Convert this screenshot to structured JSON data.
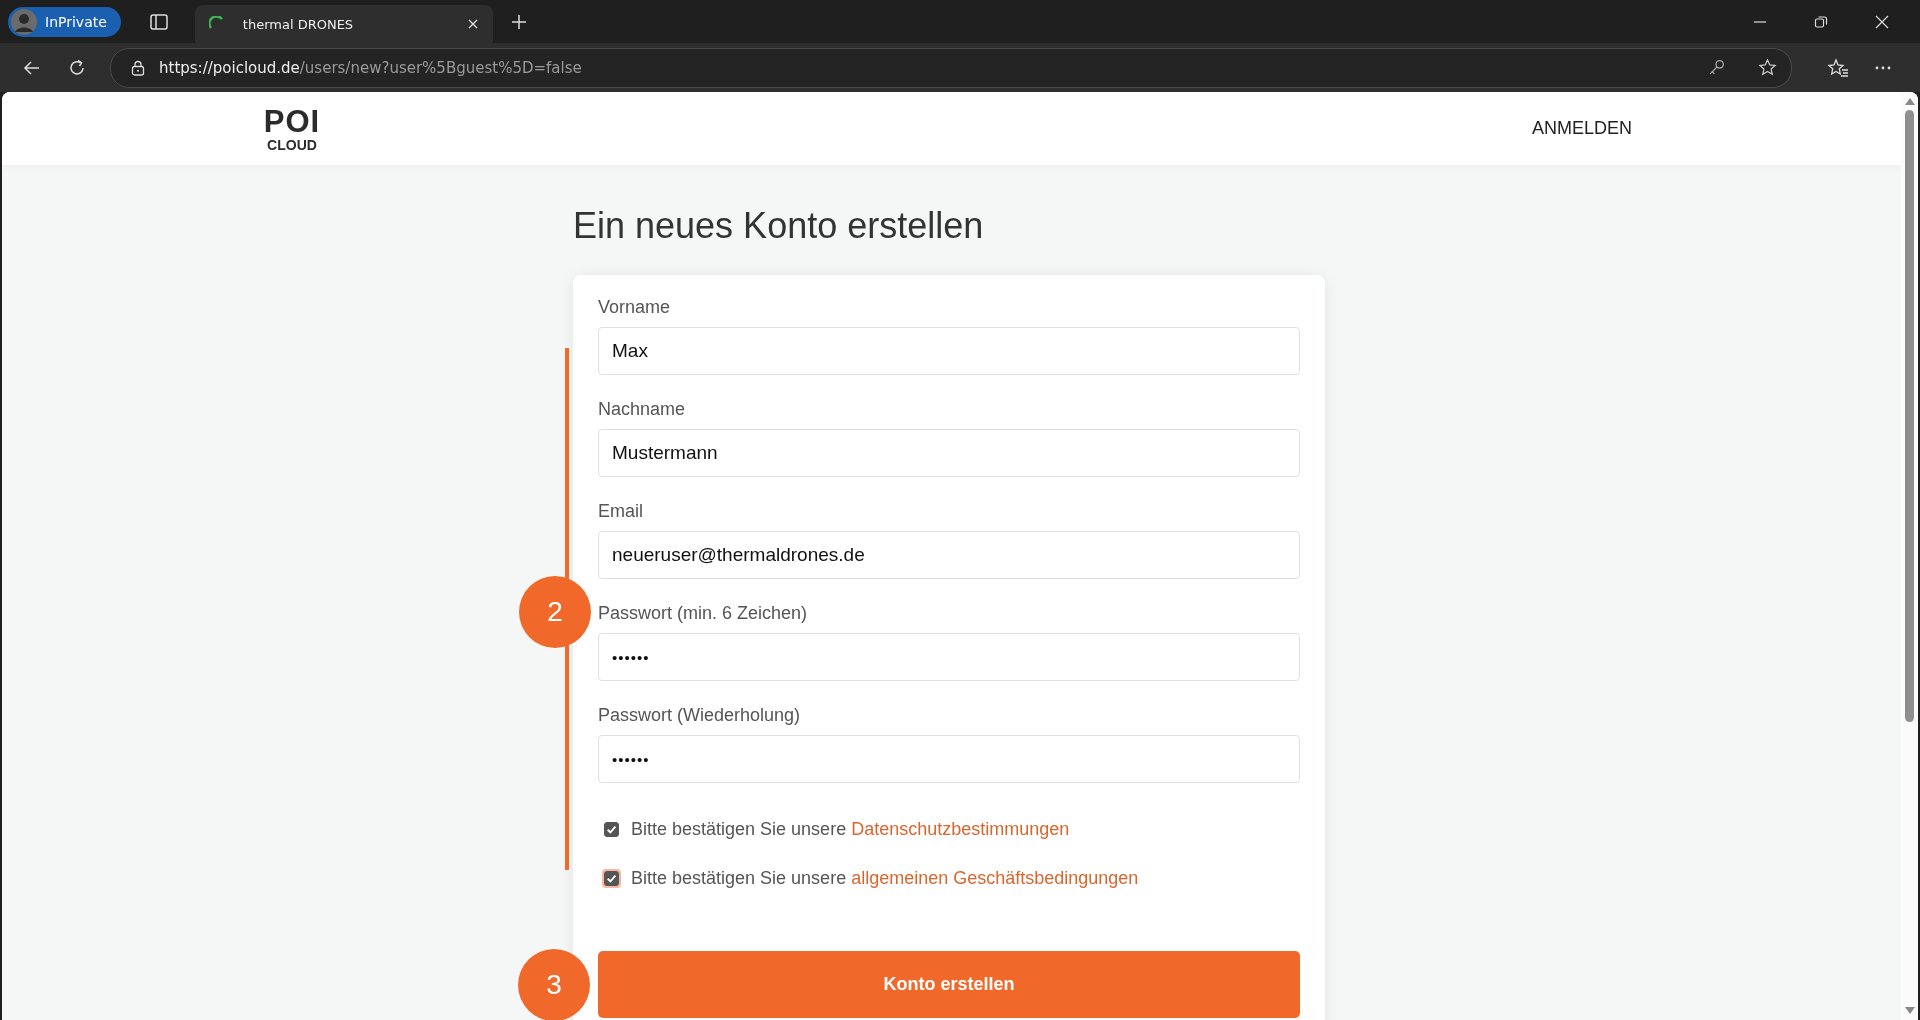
{
  "browser": {
    "profile": "InPrivate",
    "tab_title": "thermal DRONES",
    "url_host": "https://poicloud.de",
    "url_path": "/users/new?user%5Bguest%5D=false"
  },
  "header": {
    "logo_main": "POI",
    "logo_sub": "CLOUD",
    "nav_link": "ANMELDEN"
  },
  "title": "Ein neues Konto erstellen",
  "form_step": "2",
  "fields": [
    {
      "label": "Vorname",
      "value": "Max",
      "kind": "text"
    },
    {
      "label": "Nachname",
      "value": "Mustermann",
      "kind": "text"
    },
    {
      "label": "Email",
      "value": "neueruser@thermaldrones.de",
      "kind": "text"
    },
    {
      "label": "Passwort (min. 6 Zeichen)",
      "value": "••••••",
      "kind": "password"
    },
    {
      "label": "Passwort (Wiederholung)",
      "value": "••••••",
      "kind": "password"
    }
  ],
  "consents": [
    {
      "text": "Bitte bestätigen Sie unsere ",
      "link": "Datenschutzbestimmungen",
      "checked": true,
      "focused": false
    },
    {
      "text": "Bitte bestätigen Sie unsere ",
      "link": "allgemeinen Geschäftsbedingungen",
      "checked": true,
      "focused": true
    }
  ],
  "submit": {
    "label": "Konto erstellen",
    "step": "3"
  }
}
